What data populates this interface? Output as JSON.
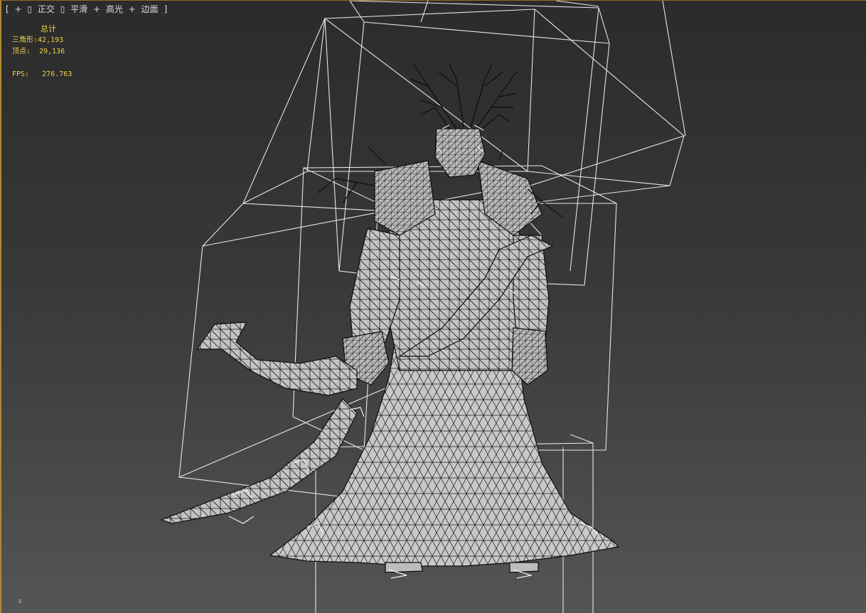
{
  "viewport": {
    "label_items": [
      "[",
      "+",
      "▯",
      "正交",
      "▯",
      "平滑",
      "+",
      "高光",
      "+",
      "边面",
      "]"
    ]
  },
  "stats": {
    "header": "总计",
    "triangles_label": "三角形:",
    "triangles_value": "42,193",
    "vertices_label": "顶点:",
    "vertices_value": "29,136",
    "fps_label": "FPS:",
    "fps_value": "276.763"
  },
  "axis": {
    "z_label": "z"
  },
  "colors": {
    "stats_text": "#f0d24a",
    "viewport_border": "#b08a2e",
    "wire_box": "#e6e6e6",
    "mesh_fill": "#bdbdbd"
  }
}
